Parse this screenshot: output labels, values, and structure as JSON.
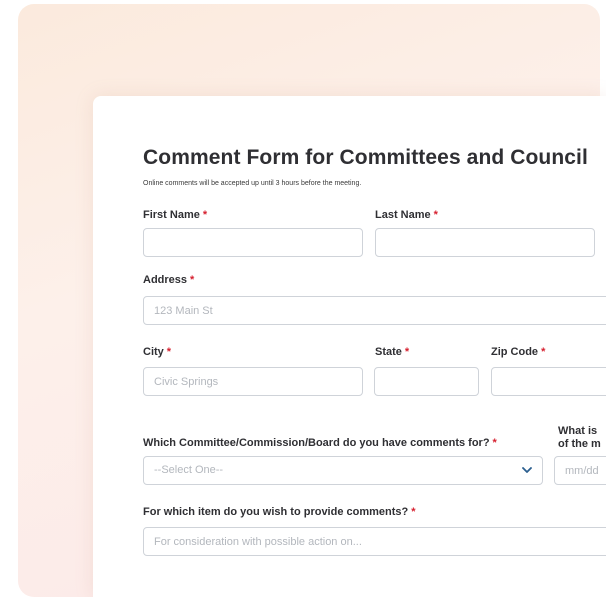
{
  "form": {
    "title": "Comment Form for Committees and Council",
    "subtitle": "Online comments will be accepted up until 3 hours before the meeting.",
    "required_mark": "*",
    "first_name": {
      "label": "First Name",
      "value": ""
    },
    "last_name": {
      "label": "Last Name",
      "value": ""
    },
    "address": {
      "label": "Address",
      "placeholder": "123 Main St"
    },
    "city": {
      "label": "City",
      "placeholder": "Civic Springs"
    },
    "state": {
      "label": "State",
      "value": ""
    },
    "zip": {
      "label": "Zip Code",
      "value": ""
    },
    "committee": {
      "label": "Which Committee/Commission/Board do you have comments for?",
      "selected": "--Select One--"
    },
    "meeting_date": {
      "label_line1": "What is",
      "label_line2": "of the m",
      "placeholder": "mm/dd"
    },
    "item": {
      "label": "For which item do you wish to provide comments?",
      "placeholder": "For consideration with possible action on..."
    }
  }
}
